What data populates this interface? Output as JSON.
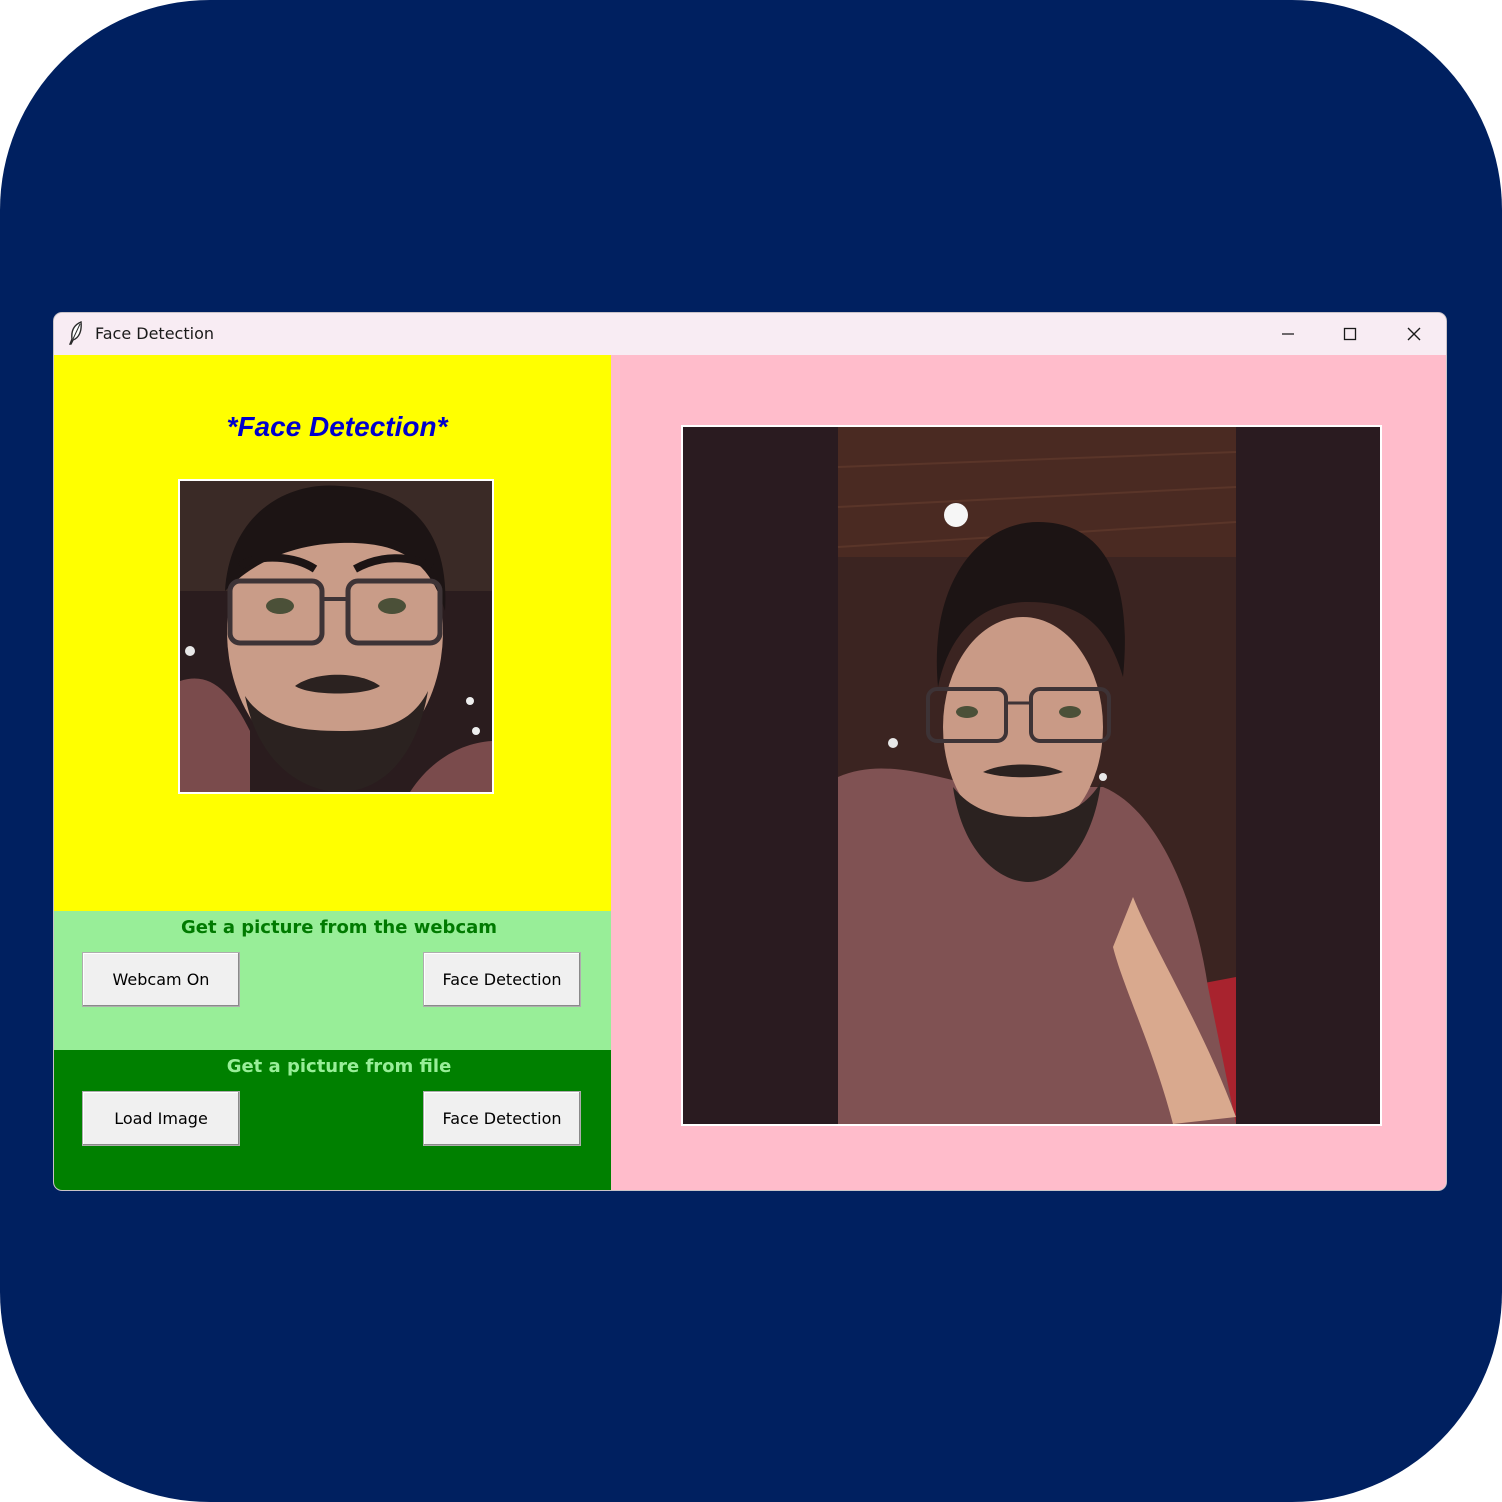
{
  "window": {
    "title": "Face Detection",
    "icon": "feather-icon",
    "controls": [
      "minimize-icon",
      "maximize-icon",
      "close-icon"
    ]
  },
  "app": {
    "heading": "*Face Detection*"
  },
  "webcam_panel": {
    "title": "Get a picture from the webcam",
    "webcam_button": "Webcam On",
    "detect_button": "Face Detection"
  },
  "file_panel": {
    "title": "Get a picture from file",
    "load_button": "Load Image",
    "detect_button": "Face Detection"
  },
  "colors": {
    "background": "#002060",
    "left_panel": "#ffff00",
    "heading": "#0000cc",
    "webcam_panel": "#98ee98",
    "file_panel": "#008000",
    "right_panel": "#ffbccb"
  }
}
